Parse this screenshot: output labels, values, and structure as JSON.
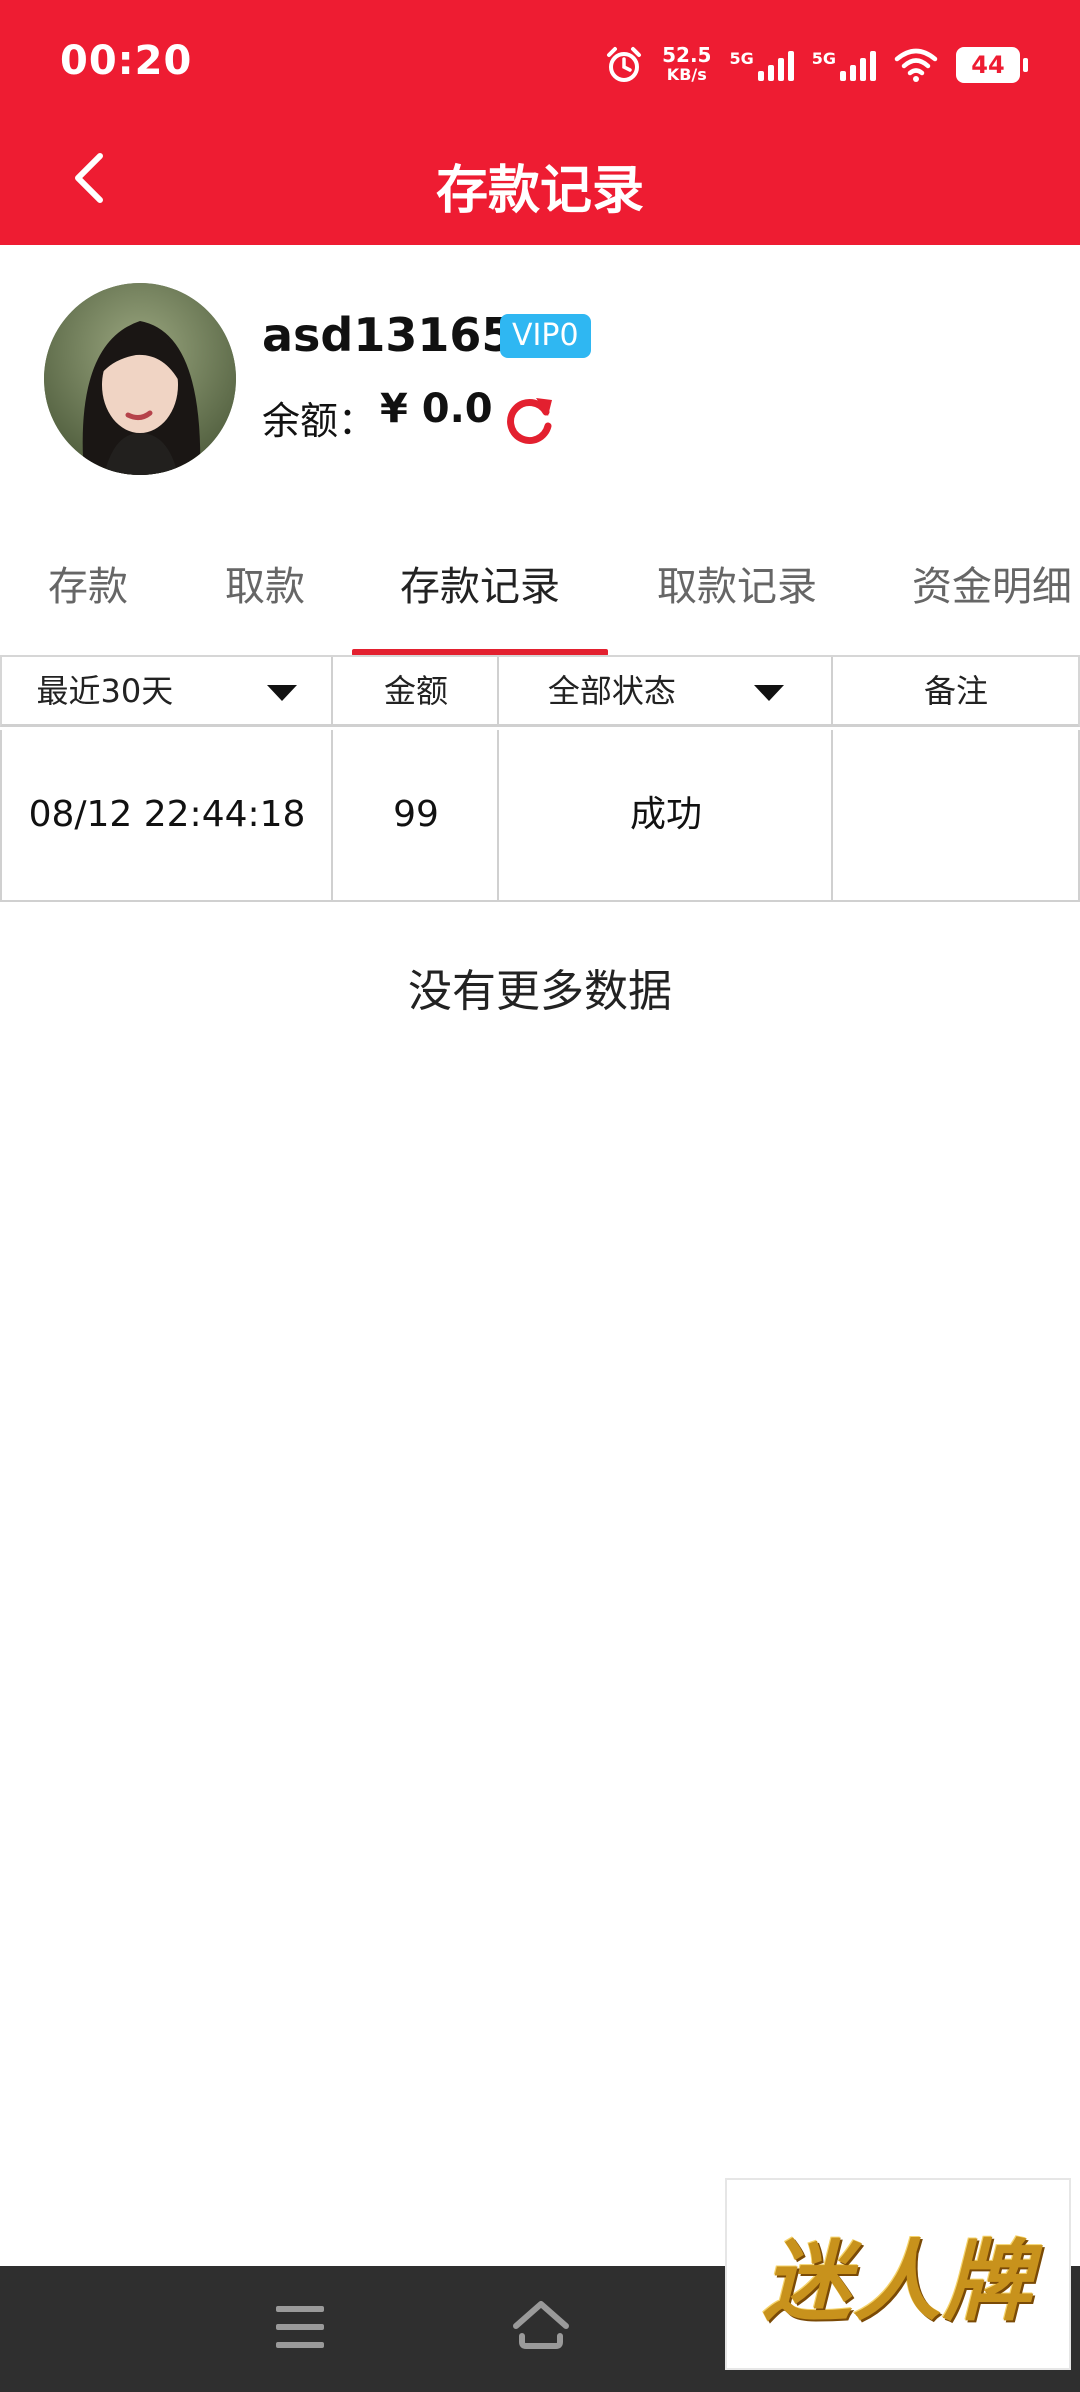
{
  "status_bar": {
    "time": "00:20",
    "speed_value": "52.5",
    "speed_unit": "KB/s",
    "net1": "5G",
    "net2": "5G",
    "battery": "44",
    "icons": [
      "alarm-icon",
      "signal-icon",
      "signal-icon",
      "wifi-icon",
      "battery-icon"
    ]
  },
  "header": {
    "title": "存款记录",
    "back_icon": "chevron-left-icon",
    "background": "#ee1c32"
  },
  "profile": {
    "username": "asd131655",
    "vip_badge": "VIP0",
    "balance_label": "余额：",
    "balance_value": "¥ 0.0",
    "refresh_icon": "refresh-icon"
  },
  "tabs": [
    {
      "label": "存款",
      "active": false
    },
    {
      "label": "取款",
      "active": false
    },
    {
      "label": "存款记录",
      "active": true
    },
    {
      "label": "取款记录",
      "active": false
    },
    {
      "label": "资金明细",
      "active": false
    }
  ],
  "table": {
    "headers": {
      "period": "最近30天",
      "amount": "金额",
      "status": "全部状态",
      "note": "备注"
    },
    "rows": [
      {
        "time": "08/12 22:44:18",
        "amount": "99",
        "status": "成功",
        "note": ""
      }
    ]
  },
  "footer_text": "没有更多数据",
  "ad": {
    "text": "迷人牌"
  },
  "nav": {
    "icons": [
      "menu-icon",
      "home-icon"
    ]
  },
  "colors": {
    "accent": "#ee1c32",
    "vip": "#2fb7f2",
    "navbar": "#2f2f2f"
  }
}
